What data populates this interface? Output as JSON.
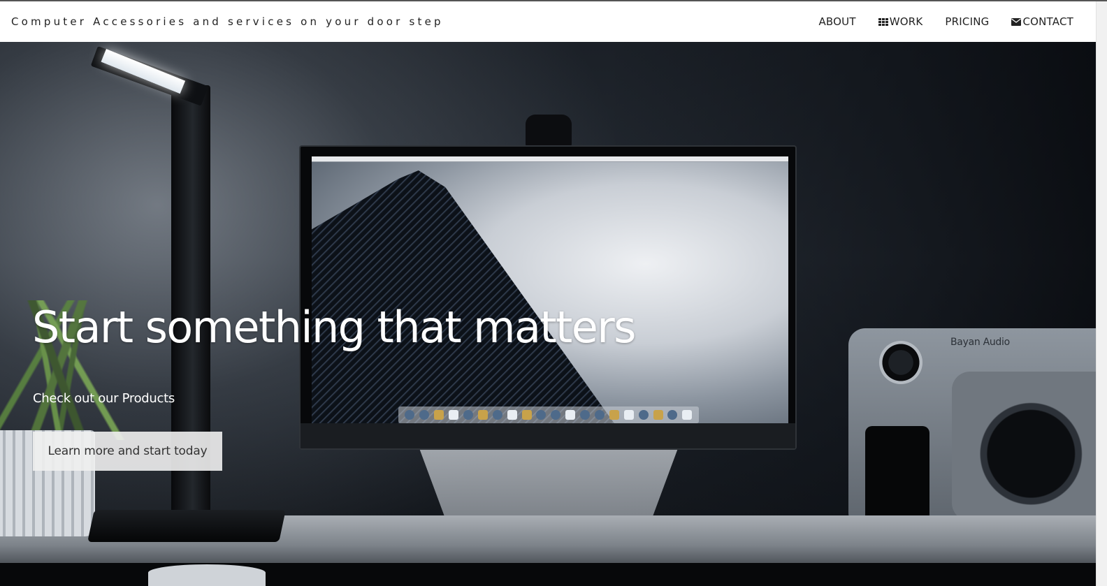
{
  "nav": {
    "brand": "Computer Accessories and services on your door step",
    "items": [
      {
        "label": "ABOUT",
        "icon": null
      },
      {
        "label": "WORK",
        "icon": "grid-icon"
      },
      {
        "label": "PRICING",
        "icon": null
      },
      {
        "label": "CONTACT",
        "icon": "envelope-icon"
      }
    ]
  },
  "hero": {
    "title": "Start something that matters",
    "subtitle": "Check out our Products",
    "cta_label": "Learn more and start today",
    "speaker_label": "Bayan Audio"
  }
}
